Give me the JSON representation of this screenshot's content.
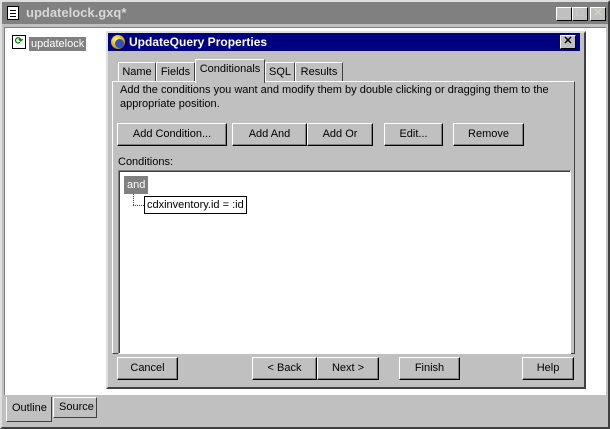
{
  "window": {
    "title": "updatelock.gxq*",
    "minimize": "_",
    "maximize": "□",
    "close": "✕"
  },
  "outline": {
    "item_label": "updatelock"
  },
  "bottom_tabs": [
    "Outline",
    "Source"
  ],
  "dialog": {
    "title": "UpdateQuery Properties",
    "close": "✕",
    "tabs": [
      "Name",
      "Fields",
      "Conditionals",
      "SQL",
      "Results"
    ],
    "active_tab": "Conditionals",
    "instructions": "Add the conditions you want and modify them by double clicking or dragging them to the appropriate position.",
    "buttons": {
      "add_condition": "Add Condition...",
      "add_and": "Add And",
      "add_or": "Add Or",
      "edit": "Edit...",
      "remove": "Remove"
    },
    "conditions_label": "Conditions:",
    "tree": {
      "root": "and",
      "child": "cdxinventory.id = :id"
    },
    "footer": {
      "cancel": "Cancel",
      "back": "< Back",
      "next": "Next >",
      "finish": "Finish",
      "help": "Help"
    }
  },
  "colors": {
    "face": "#c0c0c0",
    "title_active": "#000080",
    "title_inactive": "#808080",
    "selection": "#808080"
  }
}
